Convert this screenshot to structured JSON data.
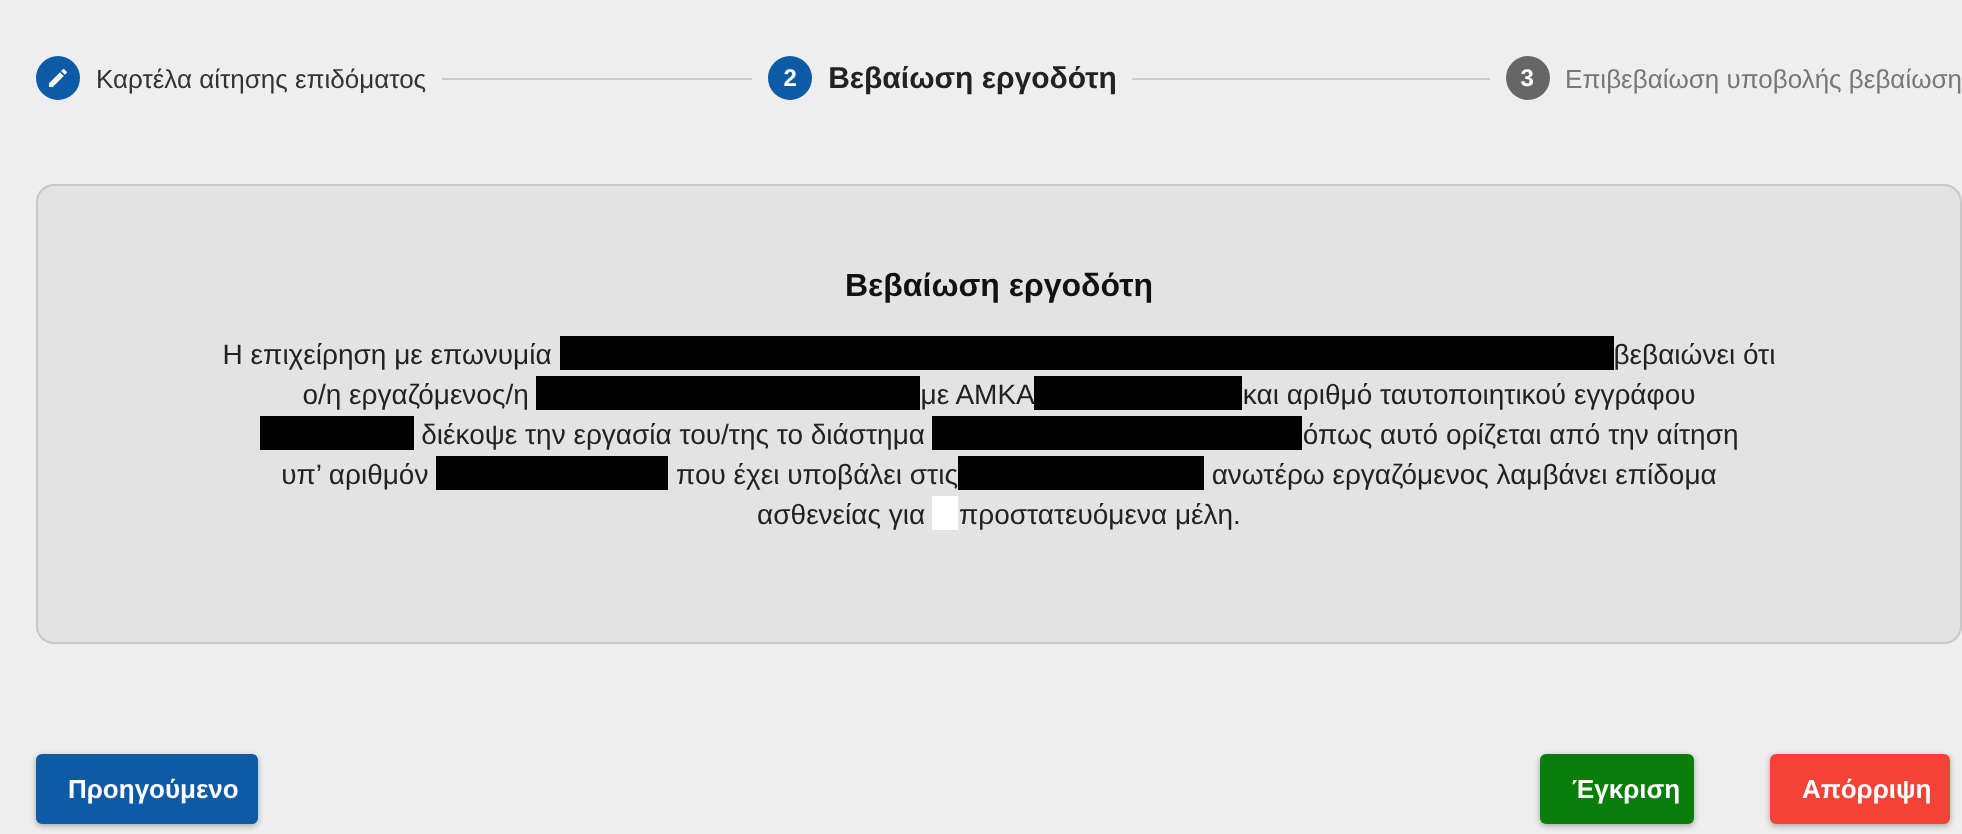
{
  "steps": [
    {
      "label": "Καρτέλα αίτησης επιδόματος",
      "completed": true,
      "selected": false
    },
    {
      "label": "Βεβαίωση εργοδότη",
      "number": "2",
      "completed": false,
      "selected": true
    },
    {
      "label": "Επιβεβαίωση υποβολής βεβαίωση",
      "number": "3",
      "completed": false,
      "selected": false
    }
  ],
  "certificate": {
    "title": "Βεβαίωση εργοδότη",
    "lines": [
      [
        {
          "kind": "text",
          "text": "Η επιχείρηση με επωνυμία "
        },
        {
          "kind": "redaction"
        },
        {
          "kind": "text",
          "text": "βεβαιώνει ότι"
        }
      ],
      [
        {
          "kind": "text",
          "text": "ο/η εργαζόμενος/η "
        },
        {
          "kind": "redaction"
        },
        {
          "kind": "text",
          "text": "με ΑΜΚΑ"
        },
        {
          "kind": "redaction"
        },
        {
          "kind": "text",
          "text": "και αριθμό ταυτοποιητικού εγγράφου"
        }
      ],
      [
        {
          "kind": "redaction"
        },
        {
          "kind": "text",
          "text": " διέκοψε την εργασία του/της το διάστημα "
        },
        {
          "kind": "redaction"
        },
        {
          "kind": "text",
          "text": "όπως αυτό ορίζεται από την αίτηση"
        }
      ],
      [
        {
          "kind": "text",
          "text": "υπ’ αριθμόν "
        },
        {
          "kind": "redaction"
        },
        {
          "kind": "text",
          "text": " που έχει υποβάλει στις"
        },
        {
          "kind": "redaction"
        },
        {
          "kind": "text",
          "text": " ανωτέρω εργαζόμενος λαμβάνει επίδομα"
        }
      ],
      [
        {
          "kind": "text",
          "text": "ασθενείας για "
        },
        {
          "kind": "blank"
        },
        {
          "kind": "text",
          "text": "προστατευόμενα μέλη."
        }
      ]
    ]
  },
  "buttons": [
    {
      "label": "Προηγούμενο",
      "kind": "primary"
    },
    {
      "label": "Έγκριση",
      "kind": "approve"
    },
    {
      "label": "Απόρριψη",
      "kind": "reject"
    }
  ]
}
